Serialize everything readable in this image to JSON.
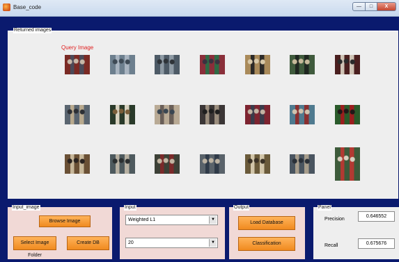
{
  "window": {
    "title": "Base_code"
  },
  "title_buttons": {
    "minimize": "—",
    "maximize": "□",
    "close": "X"
  },
  "returned_panel": {
    "title": "Returned images",
    "query_label": "Query Image"
  },
  "thumbnails": [
    {
      "role": "query",
      "colors": [
        "#7a2a24",
        "#4b4a58",
        "#c7b8a8"
      ]
    },
    {
      "role": "result",
      "colors": [
        "#6d7f8e",
        "#a9b4c0",
        "#3e4a55"
      ]
    },
    {
      "role": "result",
      "colors": [
        "#4d5a66",
        "#8e9aa4",
        "#2e3338"
      ]
    },
    {
      "role": "result",
      "colors": [
        "#8a2f3a",
        "#2f6b45",
        "#3a3240"
      ]
    },
    {
      "role": "result",
      "colors": [
        "#a98a5a",
        "#2c2a28",
        "#d7c8a8"
      ]
    },
    {
      "role": "result",
      "colors": [
        "#3f5a3c",
        "#1f2620",
        "#c7b99a"
      ]
    },
    {
      "role": "result",
      "colors": [
        "#4a1f1f",
        "#cfc3b5",
        "#2a2a2a"
      ]
    },
    {
      "role": "result",
      "colors": [
        "#5a6570",
        "#b8a98e",
        "#2c2f34"
      ]
    },
    {
      "role": "result",
      "colors": [
        "#2a3a2a",
        "#d8d2c0",
        "#7a5e3a"
      ]
    },
    {
      "role": "result",
      "colors": [
        "#b9aa95",
        "#6a5f58",
        "#3a4652"
      ]
    },
    {
      "role": "result",
      "colors": [
        "#3b3636",
        "#9b8e7e",
        "#1f1f1f"
      ]
    },
    {
      "role": "result",
      "colors": [
        "#7d2430",
        "#3b3b4a",
        "#c3b3a3"
      ]
    },
    {
      "role": "result",
      "colors": [
        "#4f7a8f",
        "#8a2f2f",
        "#d0c3ae"
      ]
    },
    {
      "role": "result",
      "colors": [
        "#2a5a2a",
        "#9a1e1e",
        "#201818"
      ]
    },
    {
      "role": "result",
      "colors": [
        "#6a5035",
        "#c7b79a",
        "#2a2320"
      ]
    },
    {
      "role": "result",
      "colors": [
        "#4e5a5e",
        "#b7b0a2",
        "#2b2f30"
      ]
    },
    {
      "role": "result",
      "colors": [
        "#3c4036",
        "#7a2a2a",
        "#c2b5a2"
      ]
    },
    {
      "role": "result",
      "colors": [
        "#59626a",
        "#2f3a48",
        "#bcb2a2"
      ]
    },
    {
      "role": "result",
      "colors": [
        "#6a5a3a",
        "#d2c6aa",
        "#3b3226"
      ]
    },
    {
      "role": "result",
      "colors": [
        "#4a5560",
        "#a79d8c",
        "#2a3038"
      ]
    },
    {
      "role": "result",
      "colors": [
        "#3d5a3a",
        "#b23a32",
        "#d8d0c0"
      ]
    }
  ],
  "input_image_panel": {
    "title": "Input_image",
    "browse_button": "Browse Image",
    "select_folder_button": "Select Image Folder",
    "create_db_button": "Create DB"
  },
  "input_panel": {
    "title": "Input",
    "method_value": "Weighted L1",
    "count_value": "20"
  },
  "output_panel": {
    "title": "Output",
    "load_db_button": "Load Database",
    "classification_button": "Classification"
  },
  "result_panel": {
    "title": "Panel",
    "precision_label": "Precision",
    "precision_value": "0.646552",
    "recall_label": "Recall",
    "recall_value": "0.675676"
  }
}
